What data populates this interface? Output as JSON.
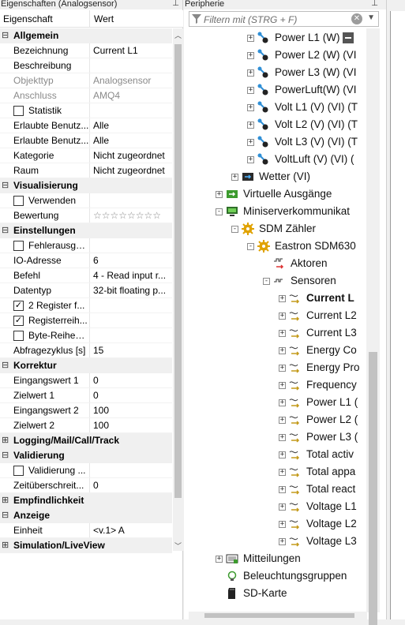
{
  "left": {
    "title": "Eigenschaften (Analogsensor)",
    "col_name": "Eigenschaft",
    "col_value": "Wert",
    "rows": [
      {
        "type": "cat",
        "exp": "⊟",
        "name": "Allgemein"
      },
      {
        "type": "prop",
        "name": "Bezeichnung",
        "value": "Current L1"
      },
      {
        "type": "prop",
        "name": "Beschreibung",
        "value": ""
      },
      {
        "type": "prop",
        "name": "Objekttyp",
        "value": "Analogsensor",
        "gray": true
      },
      {
        "type": "prop",
        "name": "Anschluss",
        "value": "AMQ4",
        "gray": true
      },
      {
        "type": "check",
        "name": "Statistik",
        "checked": false,
        "value": ""
      },
      {
        "type": "prop",
        "name": "Erlaubte Benutz...",
        "value": "Alle"
      },
      {
        "type": "prop",
        "name": "Erlaubte Benutz...",
        "value": "Alle"
      },
      {
        "type": "prop",
        "name": "Kategorie",
        "value": "Nicht zugeordnet"
      },
      {
        "type": "prop",
        "name": "Raum",
        "value": "Nicht zugeordnet"
      },
      {
        "type": "cat",
        "exp": "⊟",
        "name": "Visualisierung"
      },
      {
        "type": "check",
        "name": "Verwenden",
        "checked": false,
        "value": ""
      },
      {
        "type": "stars",
        "name": "Bewertung",
        "value": "☆☆☆☆☆☆☆☆"
      },
      {
        "type": "cat",
        "exp": "⊟",
        "name": "Einstellungen"
      },
      {
        "type": "check",
        "name": "Fehlerausga...",
        "checked": false,
        "value": ""
      },
      {
        "type": "prop",
        "name": "IO-Adresse",
        "value": "6"
      },
      {
        "type": "prop",
        "name": "Befehl",
        "value": "4 - Read input r..."
      },
      {
        "type": "prop",
        "name": "Datentyp",
        "value": "32-bit floating p..."
      },
      {
        "type": "check",
        "name": "2 Register f...",
        "checked": true,
        "value": ""
      },
      {
        "type": "check",
        "name": "Registerreih...",
        "checked": true,
        "value": ""
      },
      {
        "type": "check",
        "name": "Byte-Reihen...",
        "checked": false,
        "value": ""
      },
      {
        "type": "prop",
        "name": "Abfragezyklus [s]",
        "value": "15"
      },
      {
        "type": "cat",
        "exp": "⊟",
        "name": "Korrektur"
      },
      {
        "type": "prop",
        "name": "Eingangswert 1",
        "value": "0"
      },
      {
        "type": "prop",
        "name": "Zielwert 1",
        "value": "0"
      },
      {
        "type": "prop",
        "name": "Eingangswert 2",
        "value": "100"
      },
      {
        "type": "prop",
        "name": "Zielwert 2",
        "value": "100"
      },
      {
        "type": "cat",
        "exp": "⊞",
        "name": "Logging/Mail/Call/Track"
      },
      {
        "type": "cat",
        "exp": "⊟",
        "name": "Validierung"
      },
      {
        "type": "check",
        "name": "Validierung ...",
        "checked": false,
        "value": ""
      },
      {
        "type": "prop",
        "name": "Zeitüberschreit...",
        "value": "0"
      },
      {
        "type": "cat",
        "exp": "⊞",
        "name": "Empfindlichkeit"
      },
      {
        "type": "cat",
        "exp": "⊟",
        "name": "Anzeige"
      },
      {
        "type": "prop",
        "name": "Einheit",
        "value": "<v.1> A"
      },
      {
        "type": "cat",
        "exp": "⊞",
        "name": "Simulation/LiveView"
      }
    ]
  },
  "right": {
    "title": "Peripherie",
    "filter_placeholder": "Filtern mit (STRG + F)",
    "tree": [
      {
        "label": "Power L1 (W)",
        "icon": "meter-icon",
        "pm": "+",
        "indent": 0
      },
      {
        "label": "Power L2 (W) (VI",
        "icon": "meter-icon",
        "pm": "+",
        "indent": 0
      },
      {
        "label": "Power L3 (W) (VI",
        "icon": "meter-icon",
        "pm": "+",
        "indent": 0
      },
      {
        "label": "PowerLuft(W) (VI",
        "icon": "meter-icon",
        "pm": "+",
        "indent": 0
      },
      {
        "label": "Volt L1 (V) (VI) (T",
        "icon": "meter-icon",
        "pm": "+",
        "indent": 0
      },
      {
        "label": "Volt L2 (V) (VI) (T",
        "icon": "meter-icon",
        "pm": "+",
        "indent": 0
      },
      {
        "label": "Volt L3 (V) (VI) (T",
        "icon": "meter-icon",
        "pm": "+",
        "indent": 0
      },
      {
        "label": "VoltLuft (V) (VI) (",
        "icon": "meter-icon",
        "pm": "+",
        "indent": 0
      },
      {
        "label": "Wetter (VI)",
        "icon": "weather-icon",
        "pm": "+",
        "indent": -1
      },
      {
        "label": "Virtuelle Ausgänge",
        "icon": "virtual-output-icon",
        "pm": "+",
        "indent": -2
      },
      {
        "label": "Miniserverkommunikat",
        "icon": "network-icon",
        "pm": "−",
        "indent": -2
      },
      {
        "label": "SDM Zähler",
        "icon": "gear-icon",
        "pm": "−",
        "indent": -1
      },
      {
        "label": "Eastron SDM630",
        "icon": "gear-icon",
        "pm": "−",
        "indent": 0
      },
      {
        "label": "Aktoren",
        "icon": "actuator-icon",
        "pm": "",
        "indent": 1
      },
      {
        "label": "Sensoren",
        "icon": "sensor-folder-icon",
        "pm": "−",
        "indent": 1
      },
      {
        "label": "Current L",
        "icon": "sensor-icon",
        "pm": "+",
        "indent": 2,
        "bold": true
      },
      {
        "label": "Current L2",
        "icon": "sensor-icon",
        "pm": "+",
        "indent": 2
      },
      {
        "label": "Current L3",
        "icon": "sensor-icon",
        "pm": "+",
        "indent": 2
      },
      {
        "label": "Energy Co",
        "icon": "sensor-icon",
        "pm": "+",
        "indent": 2
      },
      {
        "label": "Energy Pro",
        "icon": "sensor-icon",
        "pm": "+",
        "indent": 2
      },
      {
        "label": "Frequency",
        "icon": "sensor-icon",
        "pm": "+",
        "indent": 2
      },
      {
        "label": "Power L1 (",
        "icon": "sensor-icon",
        "pm": "+",
        "indent": 2
      },
      {
        "label": "Power L2 (",
        "icon": "sensor-icon",
        "pm": "+",
        "indent": 2
      },
      {
        "label": "Power L3 (",
        "icon": "sensor-icon",
        "pm": "+",
        "indent": 2
      },
      {
        "label": "Total activ",
        "icon": "sensor-icon",
        "pm": "+",
        "indent": 2
      },
      {
        "label": "Total appa",
        "icon": "sensor-icon",
        "pm": "+",
        "indent": 2
      },
      {
        "label": "Total react",
        "icon": "sensor-icon",
        "pm": "+",
        "indent": 2
      },
      {
        "label": "Voltage L1",
        "icon": "sensor-icon",
        "pm": "+",
        "indent": 2
      },
      {
        "label": "Voltage L2",
        "icon": "sensor-icon",
        "pm": "+",
        "indent": 2
      },
      {
        "label": "Voltage L3",
        "icon": "sensor-icon",
        "pm": "+",
        "indent": 2
      },
      {
        "label": "Mitteilungen",
        "icon": "message-icon",
        "pm": "+",
        "indent": -2
      },
      {
        "label": "Beleuchtungsgruppen",
        "icon": "lightbulb-icon",
        "pm": "",
        "indent": -2
      },
      {
        "label": "SD-Karte",
        "icon": "sdcard-icon",
        "pm": "",
        "indent": -2
      }
    ]
  },
  "colors": {
    "panel_bg": "#f0f0f0",
    "category_bg": "#f0f0f0",
    "scroll_thumb": "#c2c2c2",
    "sensor_icon": "#c49a1a",
    "meter_icon": "#2f8fd6",
    "gear_icon": "#e0a200",
    "green_icon": "#3c9b2e"
  }
}
